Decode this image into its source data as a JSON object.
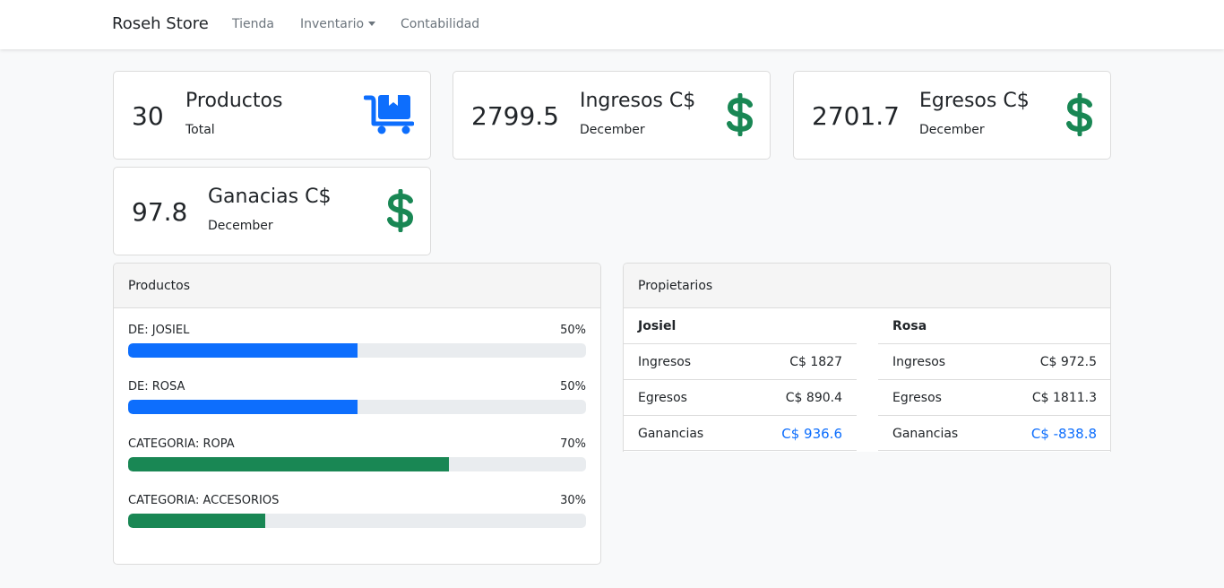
{
  "navbar": {
    "brand": "Roseh Store",
    "links": [
      {
        "label": "Tienda"
      },
      {
        "label": "Inventario",
        "dropdown": true
      },
      {
        "label": "Contabilidad"
      }
    ]
  },
  "stats": [
    {
      "value": "30",
      "title": "Productos",
      "subtitle": "Total",
      "icon": "dolly-cart-icon",
      "icon_color": "#0d6efd"
    },
    {
      "value": "2799.5",
      "title": "Ingresos C$",
      "subtitle": "December",
      "icon": "dollar-icon",
      "icon_color": "#198754"
    },
    {
      "value": "2701.7",
      "title": "Egresos C$",
      "subtitle": "December",
      "icon": "dollar-icon",
      "icon_color": "#198754"
    },
    {
      "value": "97.8",
      "title": "Ganacias C$",
      "subtitle": "December",
      "icon": "dollar-icon",
      "icon_color": "#198754"
    }
  ],
  "productos_panel": {
    "title": "Productos",
    "bars": [
      {
        "label": "DE: JOSIEL",
        "percent_label": "50%",
        "fraction": 0.5,
        "color": "#0d6efd"
      },
      {
        "label": "DE: ROSA",
        "percent_label": "50%",
        "fraction": 0.5,
        "color": "#0d6efd"
      },
      {
        "label": "CATEGORIA: ROPA",
        "percent_label": "70%",
        "fraction": 0.7,
        "color": "#198754"
      },
      {
        "label": "CATEGORIA: ACCESORIOS",
        "percent_label": "30%",
        "fraction": 0.3,
        "color": "#198754"
      }
    ]
  },
  "propietarios_panel": {
    "title": "Propietarios",
    "owners": [
      {
        "name": "Josiel",
        "rows": [
          {
            "label": "Ingresos",
            "value": "C$ 1827"
          },
          {
            "label": "Egresos",
            "value": "C$ 890.4"
          },
          {
            "label": "Ganancias",
            "value": "C$ 936.6"
          }
        ]
      },
      {
        "name": "Rosa",
        "rows": [
          {
            "label": "Ingresos",
            "value": "C$ 972.5"
          },
          {
            "label": "Egresos",
            "value": "C$ 1811.3"
          },
          {
            "label": "Ganancias",
            "value": "C$ -838.8"
          }
        ]
      }
    ],
    "highlight_color": "#0d6efd"
  }
}
